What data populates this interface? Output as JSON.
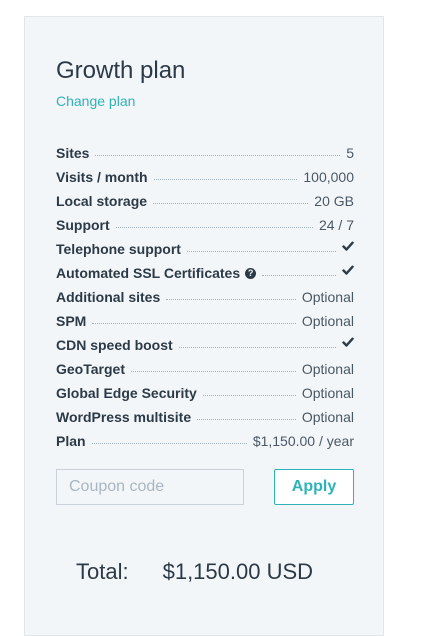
{
  "plan": {
    "title": "Growth plan",
    "change_label": "Change plan"
  },
  "features": [
    {
      "label": "Sites",
      "value": "5",
      "type": "text",
      "help": false
    },
    {
      "label": "Visits / month",
      "value": "100,000",
      "type": "text",
      "help": false
    },
    {
      "label": "Local storage",
      "value": "20 GB",
      "type": "text",
      "help": false
    },
    {
      "label": "Support",
      "value": "24 / 7",
      "type": "text",
      "help": false
    },
    {
      "label": "Telephone support",
      "value": "",
      "type": "check",
      "help": false
    },
    {
      "label": "Automated SSL Certificates",
      "value": "",
      "type": "check",
      "help": true
    },
    {
      "label": "Additional sites",
      "value": "Optional",
      "type": "text",
      "help": false
    },
    {
      "label": "SPM",
      "value": "Optional",
      "type": "text",
      "help": false
    },
    {
      "label": "CDN speed boost",
      "value": "",
      "type": "check",
      "help": false
    },
    {
      "label": "GeoTarget",
      "value": "Optional",
      "type": "text",
      "help": false
    },
    {
      "label": "Global Edge Security",
      "value": "Optional",
      "type": "text",
      "help": false
    },
    {
      "label": "WordPress multisite",
      "value": "Optional",
      "type": "text",
      "help": false
    },
    {
      "label": "Plan",
      "value": "$1,150.00 / year",
      "type": "text",
      "help": false
    }
  ],
  "icons": {
    "check": "check-icon",
    "help": "question-circle-icon"
  },
  "help_icon_glyph": "?",
  "coupon": {
    "placeholder": "Coupon code",
    "value": "",
    "apply_label": "Apply"
  },
  "total": {
    "label": "Total:",
    "amount": "$1,150.00 USD"
  },
  "colors": {
    "accent": "#2eb3b8",
    "text": "#2c3a47",
    "card_background": "#f3f6f9"
  }
}
